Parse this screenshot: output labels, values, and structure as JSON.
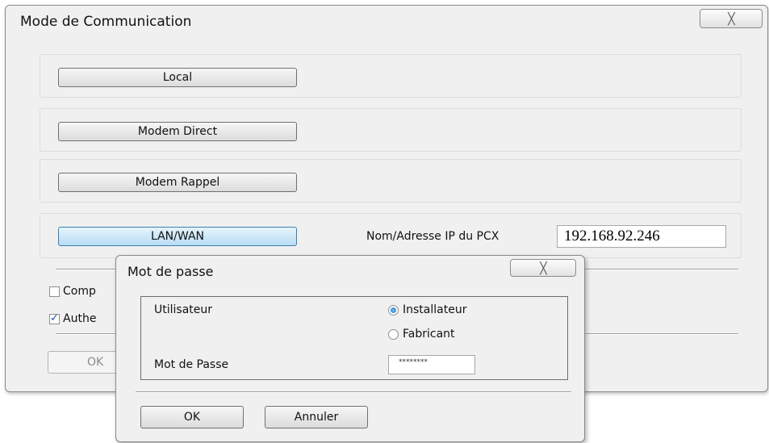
{
  "main_dialog": {
    "title": "Mode de Communication",
    "close_glyph": "╳",
    "modes": {
      "local": "Local",
      "modem_direct": "Modem Direct",
      "modem_rappel": "Modem Rappel",
      "lan_wan": "LAN/WAN"
    },
    "ip_label": "Nom/Adresse IP du PCX",
    "ip_value": "192.168.92.246",
    "checkboxes": [
      {
        "label": "Comp",
        "checked": false
      },
      {
        "label": "Authe",
        "checked": true
      }
    ],
    "ok_label": "OK"
  },
  "password_dialog": {
    "title": "Mot de passe",
    "close_glyph": "╳",
    "user_label": "Utilisateur",
    "roles": [
      {
        "label": "Installateur",
        "selected": true
      },
      {
        "label": "Fabricant",
        "selected": false
      }
    ],
    "password_label": "Mot de Passe",
    "password_value": "********",
    "ok_label": "OK",
    "cancel_label": "Annuler"
  },
  "colors": {
    "dialog_bg": "#f0f0f0",
    "active_button": "#b8dcf5",
    "radio_selected": "#1d6fb9",
    "check_mark": "#1a4fb0"
  }
}
